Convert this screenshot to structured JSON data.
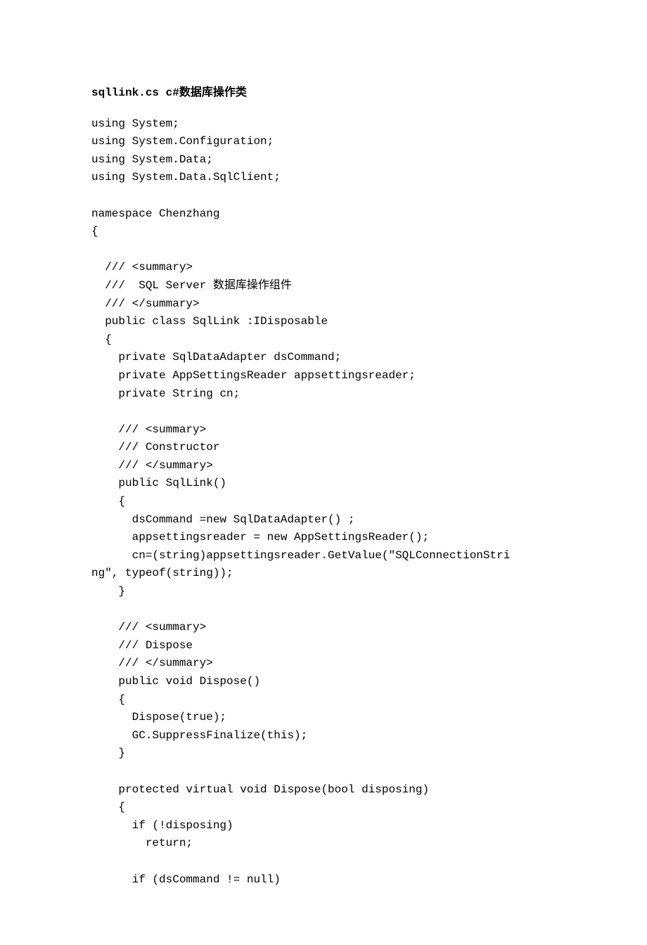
{
  "title": "sqllink.cs  c#数据库操作类",
  "code": "using System;\nusing System.Configuration;\nusing System.Data;\nusing System.Data.SqlClient;\n\nnamespace Chenzhang\n{\n\n  /// <summary>\n  ///  SQL Server 数据库操作组件\n  /// </summary>\n  public class SqlLink :IDisposable\n  {\n    private SqlDataAdapter dsCommand;\n    private AppSettingsReader appsettingsreader;\n    private String cn;\n\n    /// <summary>\n    /// Constructor\n    /// </summary>\n    public SqlLink()\n    {\n      dsCommand =new SqlDataAdapter() ;\n      appsettingsreader = new AppSettingsReader();\n      cn=(string)appsettingsreader.GetValue(\"SQLConnectionStri\nng\", typeof(string));\n    }\n\n    /// <summary>\n    /// Dispose\n    /// </summary>\n    public void Dispose()\n    {\n      Dispose(true);\n      GC.SuppressFinalize(this);\n    }\n\n    protected virtual void Dispose(bool disposing)\n    {\n      if (!disposing)\n        return;\n\n      if (dsCommand != null)"
}
